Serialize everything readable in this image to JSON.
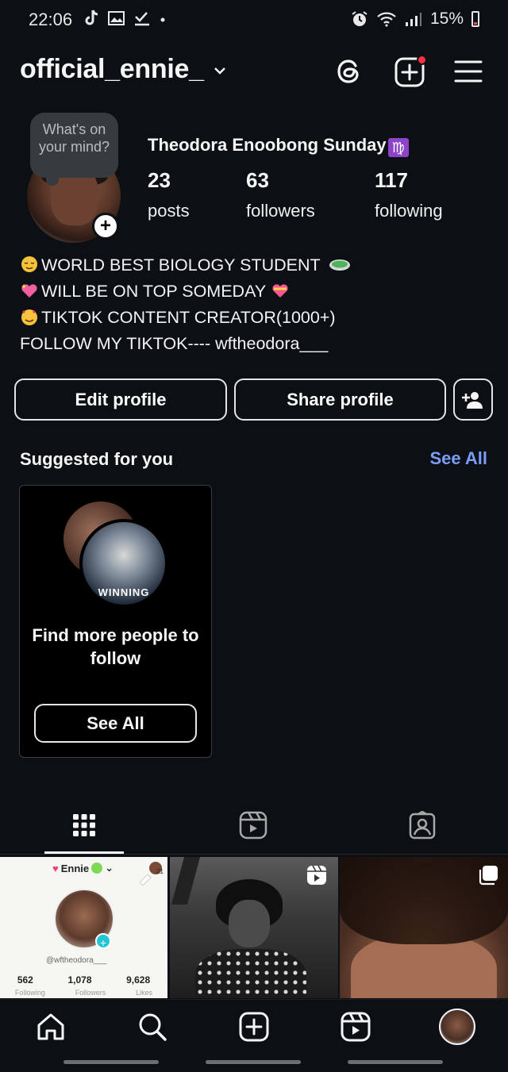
{
  "status_bar": {
    "time": "22:06",
    "battery": "15%",
    "left_icons": [
      "tiktok-icon",
      "image-icon",
      "check-icon",
      "dot-icon"
    ],
    "right_icons": [
      "alarm-icon",
      "wifi-icon",
      "signal-icon",
      "battery-icon"
    ]
  },
  "header": {
    "username": "official_ennie_",
    "icons": [
      "threads-icon",
      "create-post-icon",
      "menu-icon"
    ],
    "accent_dot_color": "#ff3040"
  },
  "profile": {
    "note": "What's on your mind?",
    "full_name": "Theodora Enoobong Sunday",
    "zodiac": "♍",
    "stats": [
      {
        "value": "23",
        "label": "posts"
      },
      {
        "value": "63",
        "label": "followers"
      },
      {
        "value": "117",
        "label": "following"
      }
    ],
    "bio": [
      "WORLD BEST BIOLOGY STUDENT",
      "WILL BE ON TOP SOMEDAY",
      "TIKTOK CONTENT CREATOR(1000+)",
      "FOLLOW MY TIKTOK---- wftheodora___"
    ]
  },
  "actions": {
    "edit_profile": "Edit profile",
    "share_profile": "Share profile"
  },
  "suggested": {
    "title": "Suggested for you",
    "see_all_link": "See All",
    "card_text": "Find more people to follow",
    "card_button": "See All",
    "card_image_text": "WINNING"
  },
  "tabs": [
    "grid-icon",
    "reels-icon",
    "tagged-icon"
  ],
  "grid": {
    "tile1": {
      "name": "Ennie",
      "pin_count": "21",
      "handle": "@wftheodora___",
      "stats": [
        "562",
        "1,078",
        "9,628"
      ],
      "stat_labels": [
        "Following",
        "Followers",
        "Likes"
      ]
    }
  },
  "colors": {
    "background": "#0c1014",
    "link": "#7a9df7"
  }
}
